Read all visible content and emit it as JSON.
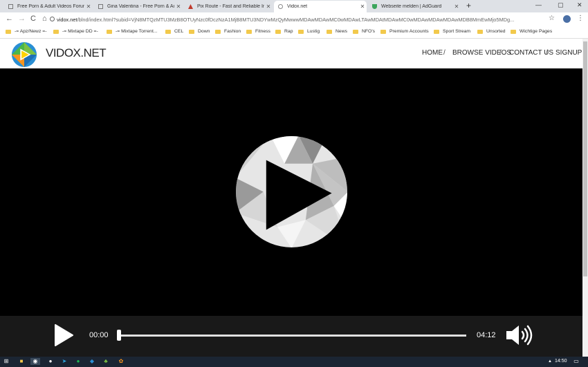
{
  "browser": {
    "tabs": [
      {
        "label": "Free Porn & Adult Videos Forum",
        "active": false
      },
      {
        "label": "Gina Valentina - Free Porn & Adu",
        "active": false
      },
      {
        "label": "Pix Route - Fast and Reliable Ima",
        "active": false
      },
      {
        "label": "Vidox.net",
        "active": true
      },
      {
        "label": "Webseite melden | AdGuard",
        "active": false
      }
    ],
    "new_tab": "+",
    "window_controls": {
      "minimize": "—",
      "maximize": "▢",
      "close": "✕"
    },
    "nav": {
      "back": "←",
      "forward": "→",
      "reload": "C",
      "home": "⌂"
    },
    "url": {
      "host": "vidox.net",
      "path": "/blnd/index.html?subid=VjN8MTQzMTU3MzB8OTUyNzc0fDczNzA1MjB8MTU3NDYwMzQyMwwwMDAwMDAwMC0wMDAwLTAwMDAtMDAwMC0wMDAwMDAwMDAwMDB8MmEwMjo5MDg..."
    },
    "bookmarks": [
      {
        "label": "-= Apz/Newz =-"
      },
      {
        "label": "-= Mixtape DD =-"
      },
      {
        "label": "-= Mixtape Torrent..."
      },
      {
        "label": "CEL"
      },
      {
        "label": "Down"
      },
      {
        "label": "Fashion"
      },
      {
        "label": "Fitness"
      },
      {
        "label": "Rap"
      },
      {
        "label": "Lustig"
      },
      {
        "label": "News"
      },
      {
        "label": "NFO's"
      },
      {
        "label": "Premium Accounts"
      },
      {
        "label": "Sport Stream"
      },
      {
        "label": "Unsorted"
      },
      {
        "label": "Wichtige Pages"
      }
    ]
  },
  "site": {
    "brand": "VIDOX.NET",
    "nav": [
      {
        "label": "HOME"
      },
      {
        "label": "BROWSE VIDEOS"
      },
      {
        "label": "CONTACT US"
      },
      {
        "label": "SIGNUP"
      }
    ],
    "nav_separator": "/"
  },
  "player": {
    "current_time": "00:00",
    "duration": "04:12",
    "progress": 0.0
  },
  "taskbar": {
    "clock": "14:50"
  },
  "colors": {
    "chrome_bg": "#dee1e6",
    "controls_bg": "#191919",
    "logo_green": "#7dc242",
    "logo_blue": "#2a8fd4",
    "logo_orange": "#f7941d",
    "logo_yellow": "#ffd200"
  }
}
